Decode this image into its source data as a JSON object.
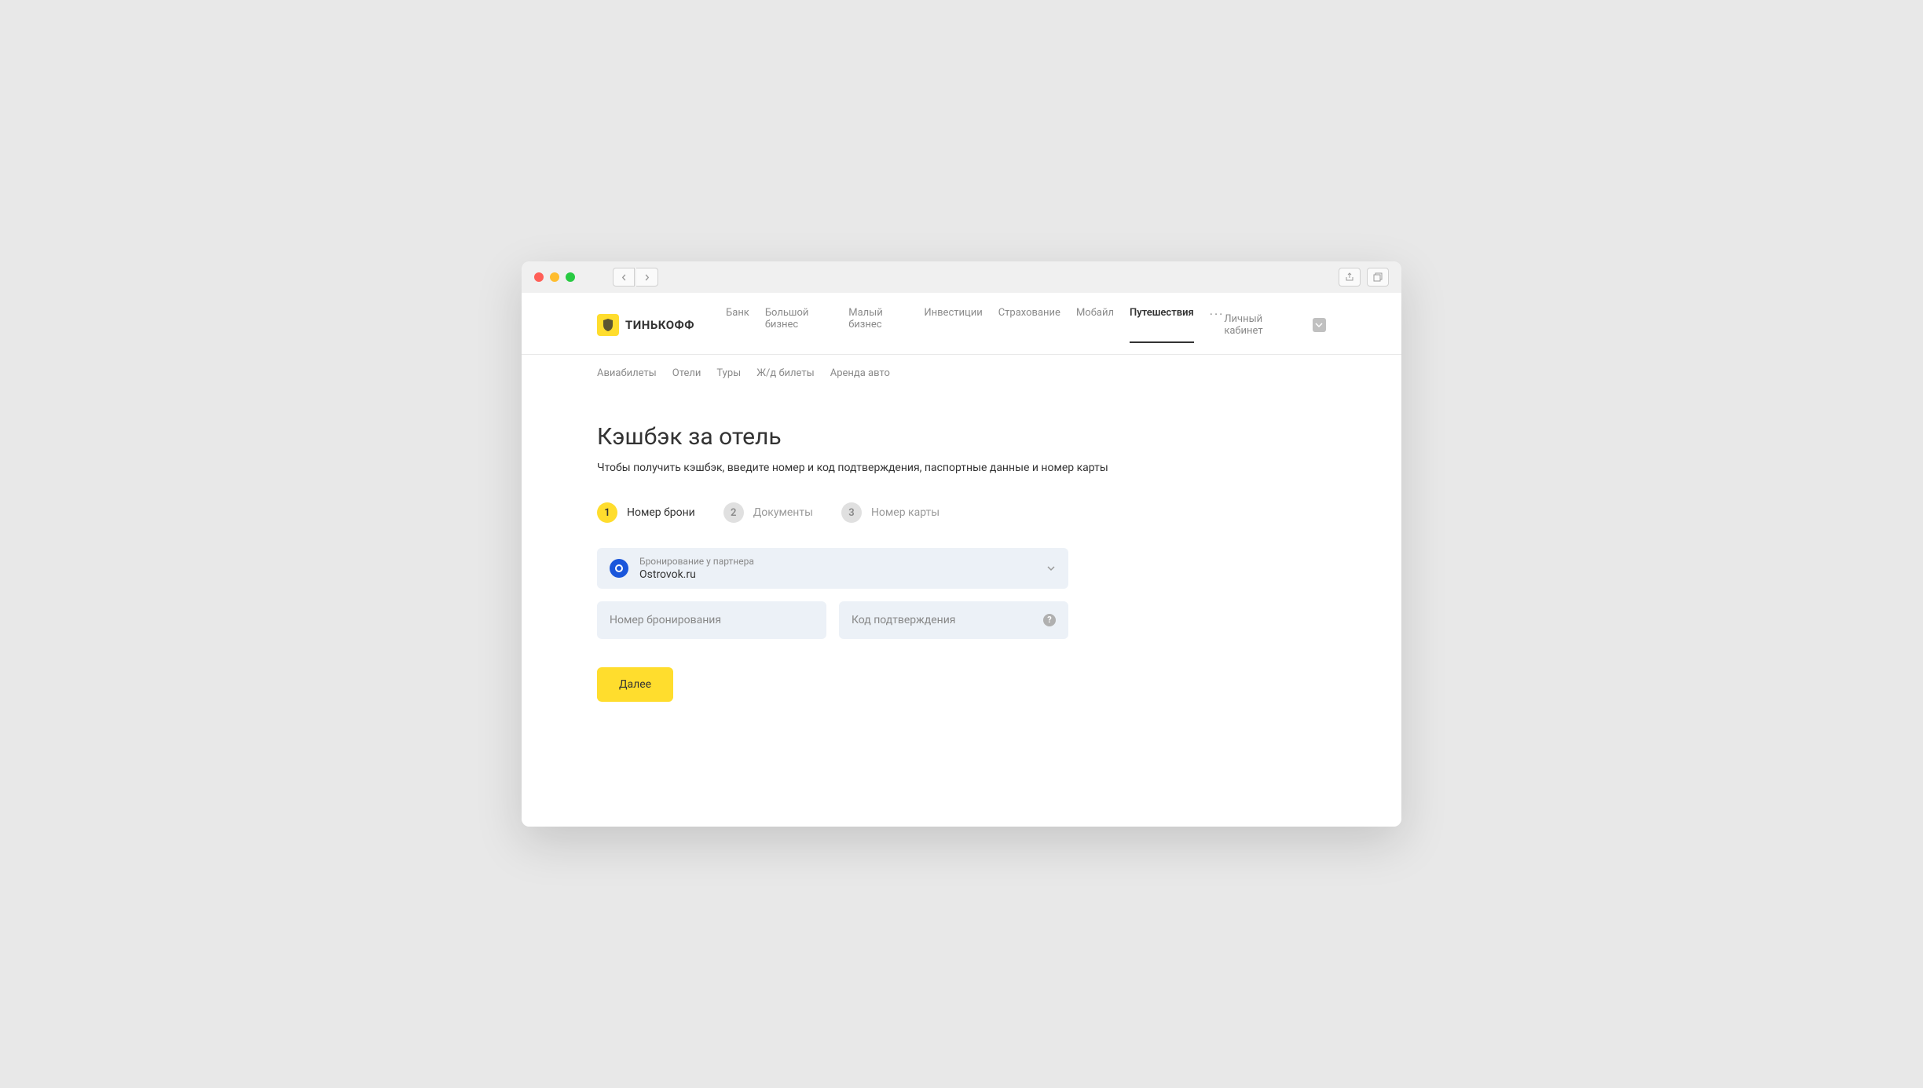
{
  "brand": {
    "name": "ТИНЬКОФФ"
  },
  "mainNav": {
    "items": [
      {
        "label": "Банк",
        "active": false
      },
      {
        "label": "Большой бизнес",
        "active": false
      },
      {
        "label": "Малый бизнес",
        "active": false
      },
      {
        "label": "Инвестиции",
        "active": false
      },
      {
        "label": "Страхование",
        "active": false
      },
      {
        "label": "Мобайл",
        "active": false
      },
      {
        "label": "Путешествия",
        "active": true
      }
    ]
  },
  "headerRight": {
    "personalCabinet": "Личный кабинет"
  },
  "subNav": {
    "items": [
      {
        "label": "Авиабилеты"
      },
      {
        "label": "Отели"
      },
      {
        "label": "Туры"
      },
      {
        "label": "Ж/д билеты"
      },
      {
        "label": "Аренда авто"
      }
    ]
  },
  "page": {
    "title": "Кэшбэк за отель",
    "subtitle": "Чтобы получить кэшбэк, введите номер и код подтверждения, паспортные данные и номер карты"
  },
  "stepper": {
    "steps": [
      {
        "number": "1",
        "label": "Номер брони",
        "active": true
      },
      {
        "number": "2",
        "label": "Документы",
        "active": false
      },
      {
        "number": "3",
        "label": "Номер карты",
        "active": false
      }
    ]
  },
  "form": {
    "partner": {
      "label": "Бронирование у партнера",
      "value": "Ostrovok.ru"
    },
    "bookingNumber": {
      "placeholder": "Номер бронирования",
      "value": ""
    },
    "confirmationCode": {
      "placeholder": "Код подтверждения",
      "value": ""
    },
    "submitLabel": "Далее"
  }
}
